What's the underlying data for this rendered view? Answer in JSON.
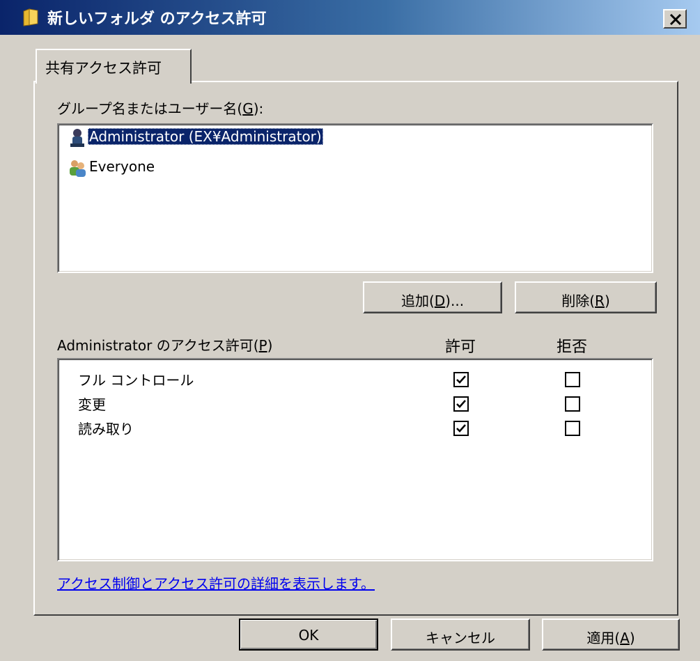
{
  "window": {
    "title": "新しいフォルダ のアクセス許可",
    "close_label": "×"
  },
  "tabs": [
    {
      "label": "共有アクセス許可",
      "selected": true
    }
  ],
  "group_section": {
    "label_prefix": "グループ名またはユーザー名(",
    "label_mnemonic": "G",
    "label_suffix": "):",
    "users": [
      {
        "name": "Administrator (EX¥Administrator)",
        "icon": "user-icon",
        "selected": true
      },
      {
        "name": "Everyone",
        "icon": "group-icon",
        "selected": false
      }
    ],
    "add_button": {
      "prefix": "追加(",
      "mnemonic": "D",
      "suffix": ")..."
    },
    "remove_button": {
      "prefix": "削除(",
      "mnemonic": "R",
      "suffix": ")"
    }
  },
  "permissions": {
    "label_prefix": "Administrator のアクセス許可(",
    "label_mnemonic": "P",
    "label_suffix": ")",
    "allow_header": "許可",
    "deny_header": "拒否",
    "rows": [
      {
        "name": "フル コントロール",
        "allow": true,
        "deny": false
      },
      {
        "name": "変更",
        "allow": true,
        "deny": false
      },
      {
        "name": "読み取り",
        "allow": true,
        "deny": false
      }
    ]
  },
  "help_link": "アクセス制御とアクセス許可の詳細を表示します。",
  "footer": {
    "ok": "OK",
    "cancel": "キャンセル",
    "apply_prefix": "適用(",
    "apply_mnemonic": "A",
    "apply_suffix": ")"
  },
  "colors": {
    "title_start": "#0a246a",
    "title_end": "#a6caf0",
    "face": "#d4d0c8",
    "selection": "#0a246a",
    "link": "#0000ee"
  }
}
